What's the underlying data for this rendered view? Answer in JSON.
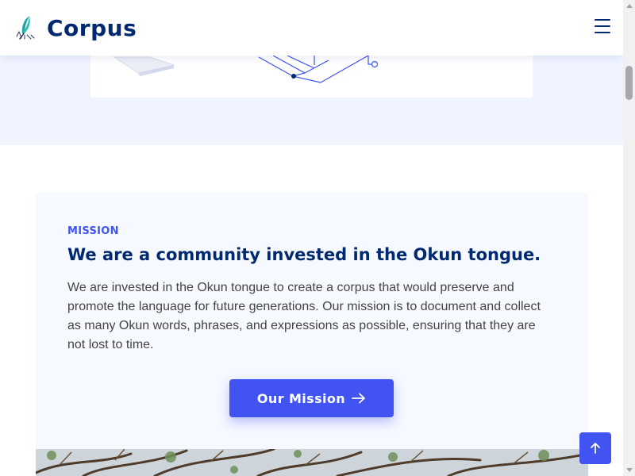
{
  "header": {
    "brand": "Corpus",
    "logo_icon": "quill-logo-icon",
    "menu_icon": "hamburger-menu-icon"
  },
  "mission": {
    "label": "MISSION",
    "title": "We are a community invested in the Okun tongue.",
    "text": "We are invested in the Okun tongue to create a corpus that would preserve and promote the language for future generations. Our mission is to document and collect as many Okun words, phrases, and expressions as possible, ensuring that they are not lost to time.",
    "button_label": "Our Mission",
    "button_icon": "arrow-right-icon"
  },
  "back_to_top": {
    "icon": "arrow-up-icon"
  },
  "colors": {
    "primary": "#4154f1",
    "heading": "#012970",
    "hero_background": "#f0f4ff",
    "card_background": "#f6f9ff",
    "body_text": "#444444"
  }
}
